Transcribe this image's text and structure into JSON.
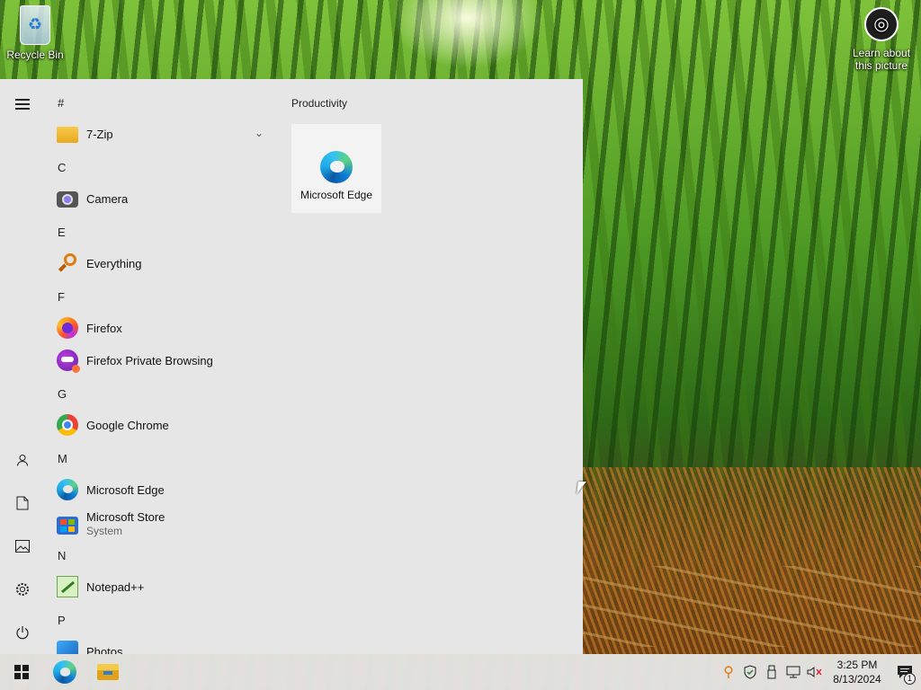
{
  "desktop": {
    "recycle_bin_label": "Recycle Bin",
    "learn_line1": "Learn about",
    "learn_line2": "this picture"
  },
  "start_menu": {
    "sections": [
      {
        "letter": "#"
      },
      {
        "letter": "C"
      },
      {
        "letter": "E"
      },
      {
        "letter": "F"
      },
      {
        "letter": "G"
      },
      {
        "letter": "M"
      },
      {
        "letter": "N"
      },
      {
        "letter": "P"
      }
    ],
    "apps": {
      "seven_zip": "7-Zip",
      "camera": "Camera",
      "everything": "Everything",
      "firefox": "Firefox",
      "firefox_private": "Firefox Private Browsing",
      "chrome": "Google Chrome",
      "edge": "Microsoft Edge",
      "store": "Microsoft Store",
      "store_sub": "System",
      "notepadpp": "Notepad++",
      "photos": "Photos"
    },
    "tiles": {
      "group_title": "Productivity",
      "edge_tile": "Microsoft Edge"
    }
  },
  "taskbar": {
    "time": "3:25 PM",
    "date": "8/13/2024",
    "notification_count": "1"
  },
  "colors": {
    "start_bg": "#e6e6e6",
    "taskbar_bg": "#ececec",
    "tile_bg": "#f3f3f3"
  }
}
